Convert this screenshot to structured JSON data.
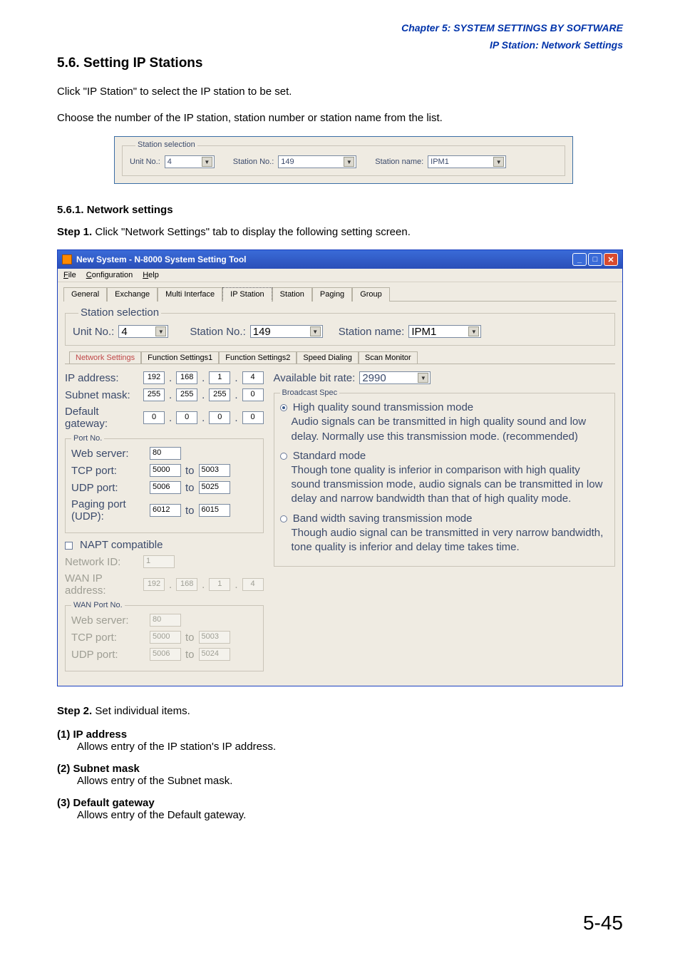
{
  "header": {
    "chapter": "Chapter 5:  SYSTEM SETTINGS BY SOFTWARE",
    "section": "IP Station: Network Settings"
  },
  "title": "5.6. Setting IP Stations",
  "intro1": "Click \"IP Station\" to select the IP station to be set.",
  "intro2": "Choose the number of the IP station, station number or station name from the list.",
  "ss1": {
    "legend": "Station selection",
    "unitno_label": "Unit No.:",
    "unitno_value": "4",
    "stationno_label": "Station No.:",
    "stationno_value": "149",
    "stationname_label": "Station name:",
    "stationname_value": "IPM1"
  },
  "sub1_title": "5.6.1. Network settings",
  "step1_label": "Step 1.",
  "step1_text": " Click \"Network Settings\" tab to display the following setting screen.",
  "win": {
    "title": "New System - N-8000 System Setting Tool",
    "menu": {
      "file": "File",
      "config": "Configuration",
      "help": "Help"
    },
    "maintabs": {
      "general": "General",
      "exchange": "Exchange",
      "multi": "Multi Interface",
      "ipstation": "IP Station",
      "station": "Station",
      "paging": "Paging",
      "group": "Group"
    },
    "sel": {
      "legend": "Station selection",
      "unitno_label": "Unit No.:",
      "unitno_value": "4",
      "stationno_label": "Station No.:",
      "stationno_value": "149",
      "stationname_label": "Station name:",
      "stationname_value": "IPM1"
    },
    "subtabs": {
      "ns": "Network Settings",
      "f1": "Function Settings1",
      "f2": "Function Settings2",
      "sd": "Speed Dialing",
      "sm": "Scan Monitor"
    },
    "left": {
      "ipaddress_label": "IP address:",
      "ip": [
        "192",
        "168",
        "1",
        "4"
      ],
      "subnet_label": "Subnet mask:",
      "sm": [
        "255",
        "255",
        "255",
        "0"
      ],
      "gateway_label": "Default gateway:",
      "gw": [
        "0",
        "0",
        "0",
        "0"
      ],
      "portno_legend": "Port No.",
      "web_label": "Web server:",
      "web_val": "80",
      "tcp_label": "TCP port:",
      "tcp_from": "5000",
      "to_label": "to",
      "tcp_to": "5003",
      "udp_label": "UDP port:",
      "udp_from": "5006",
      "udp_to": "5025",
      "paging_label": "Paging port (UDP):",
      "paging_from": "6012",
      "paging_to": "6015",
      "napt_label": "NAPT compatible",
      "netid_label": "Network ID:",
      "netid_val": "1",
      "wanip_label": "WAN IP address:",
      "wanip": [
        "192",
        "168",
        "1",
        "4"
      ],
      "wanport_legend": "WAN Port No.",
      "wweb_label": "Web server:",
      "wweb_val": "80",
      "wtcp_label": "TCP port:",
      "wtcp_from": "5000",
      "wtcp_to": "5003",
      "wudp_label": "UDP port:",
      "wudp_from": "5006",
      "wudp_to": "5024"
    },
    "right": {
      "abr_label": "Available bit rate:",
      "abr_val": "2990",
      "bspec_legend": "Broadcast Spec",
      "r1_title": "High quality sound transmission mode",
      "r1_desc": "Audio signals can be transmitted in high quality sound and low delay. Normally use this transmission mode. (recommended)",
      "r2_title": "Standard mode",
      "r2_desc": "Though tone quality is inferior in comparison with high quality sound transmission mode, audio signals can be transmitted in low delay and narrow bandwidth than that of high quality mode.",
      "r3_title": "Band width saving transmission mode",
      "r3_desc": "Though audio signal can be transmitted in very narrow bandwidth, tone quality is inferior and delay time takes time."
    }
  },
  "step2_label": "Step 2.",
  "step2_text": " Set individual items.",
  "items": {
    "n1": "(1)",
    "t1": "IP address",
    "d1": "Allows entry of the IP station's IP address.",
    "n2": "(2)",
    "t2": "Subnet mask",
    "d2": "Allows entry of the Subnet mask.",
    "n3": "(3)",
    "t3": "Default gateway",
    "d3": "Allows entry of the Default gateway."
  },
  "page_number": "5-45"
}
